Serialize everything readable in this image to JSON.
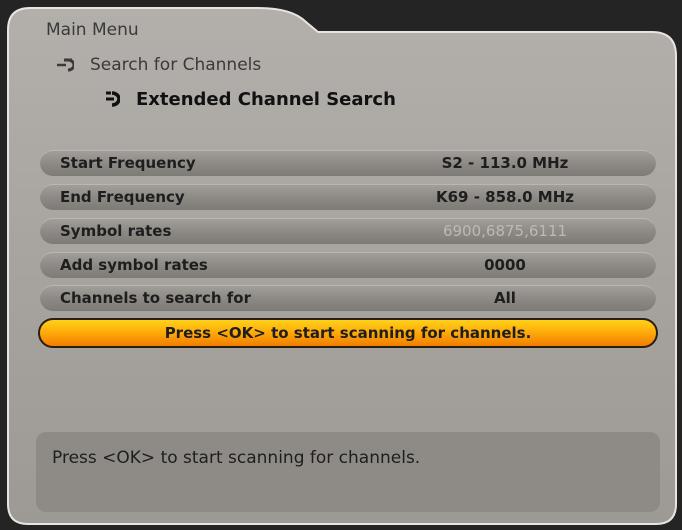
{
  "breadcrumb": {
    "title": "Main Menu",
    "level1": "Search for Channels",
    "level2": "Extended Channel Search"
  },
  "settings": [
    {
      "label": "Start Frequency",
      "value": "S2 - 113.0 MHz"
    },
    {
      "label": "End Frequency",
      "value": "K69 - 858.0 MHz"
    },
    {
      "label": "Symbol rates",
      "value": "6900,6875,6111"
    },
    {
      "label": "Add symbol rates",
      "value": "0000"
    },
    {
      "label": "Channels to search for",
      "value": "All"
    }
  ],
  "action": {
    "label": "Press <OK> to start scanning for channels."
  },
  "help": {
    "text": "Press <OK> to start scanning for channels."
  },
  "colors": {
    "accent": "#ffac0a",
    "panel": "#a5a19d",
    "row": "#8c8884"
  },
  "icons": {
    "breadcrumb": "return-arrow-icon"
  }
}
